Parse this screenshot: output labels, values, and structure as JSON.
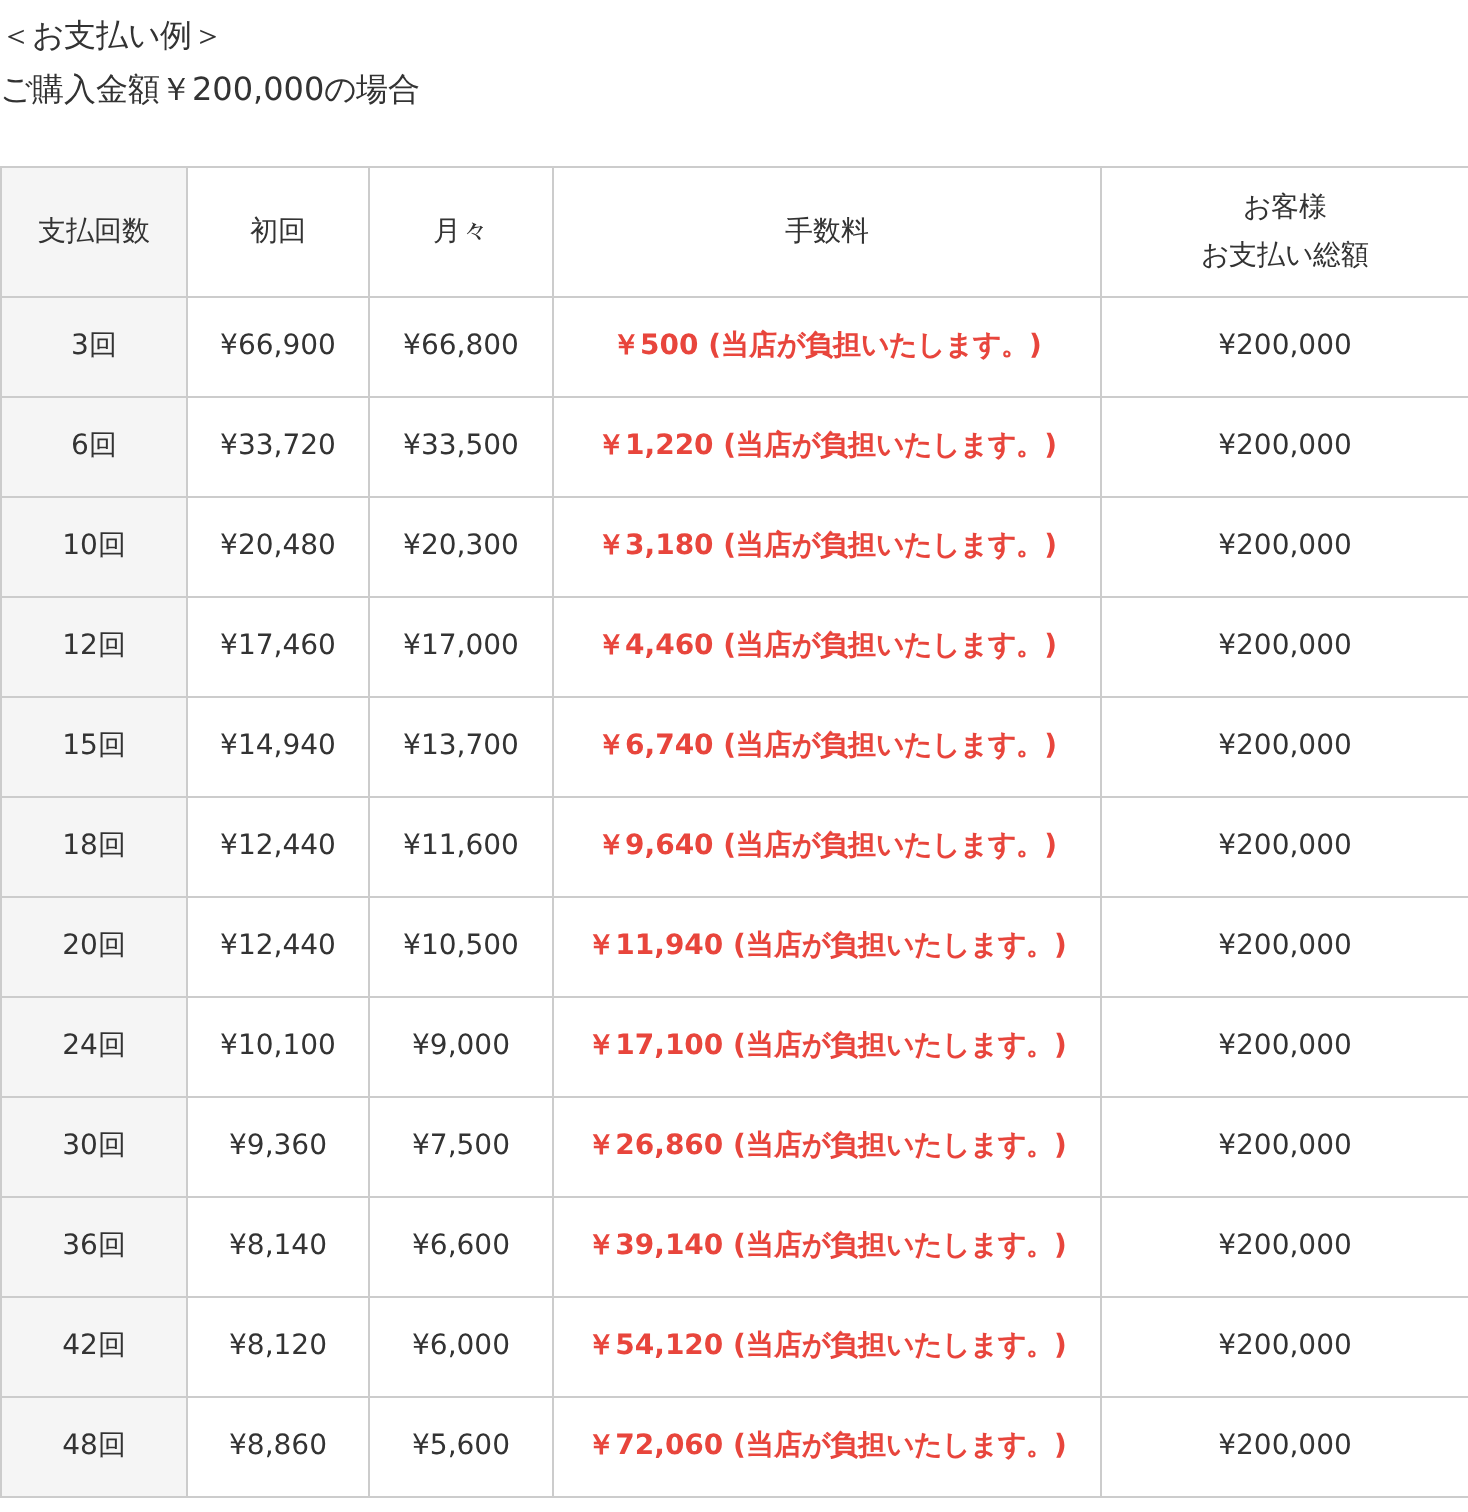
{
  "title_lines": [
    "＜お支払い例＞",
    "ご購入金額￥200,000の場合"
  ],
  "table": {
    "columns": [
      {
        "lines": [
          "支払回数"
        ]
      },
      {
        "lines": [
          "初回"
        ]
      },
      {
        "lines": [
          "月々"
        ]
      },
      {
        "lines": [
          "手数料"
        ]
      },
      {
        "lines": [
          "お客様",
          "お支払い総額"
        ]
      }
    ],
    "rows": [
      [
        "3回",
        "¥66,900",
        "¥66,800",
        "￥500 (当店が負担いたします。)",
        "¥200,000"
      ],
      [
        "6回",
        "¥33,720",
        "¥33,500",
        "￥1,220 (当店が負担いたします。)",
        "¥200,000"
      ],
      [
        "10回",
        "¥20,480",
        "¥20,300",
        "￥3,180 (当店が負担いたします。)",
        "¥200,000"
      ],
      [
        "12回",
        "¥17,460",
        "¥17,000",
        "￥4,460 (当店が負担いたします。)",
        "¥200,000"
      ],
      [
        "15回",
        "¥14,940",
        "¥13,700",
        "￥6,740 (当店が負担いたします。)",
        "¥200,000"
      ],
      [
        "18回",
        "¥12,440",
        "¥11,600",
        "￥9,640 (当店が負担いたします。)",
        "¥200,000"
      ],
      [
        "20回",
        "¥12,440",
        "¥10,500",
        "￥11,940 (当店が負担いたします。)",
        "¥200,000"
      ],
      [
        "24回",
        "¥10,100",
        "¥9,000",
        "￥17,100 (当店が負担いたします。)",
        "¥200,000"
      ],
      [
        "30回",
        "¥9,360",
        "¥7,500",
        "￥26,860 (当店が負担いたします。)",
        "¥200,000"
      ],
      [
        "36回",
        "¥8,140",
        "¥6,600",
        "￥39,140 (当店が負担いたします。)",
        "¥200,000"
      ],
      [
        "42回",
        "¥8,120",
        "¥6,000",
        "￥54,120 (当店が負担いたします。)",
        "¥200,000"
      ],
      [
        "48回",
        "¥8,860",
        "¥5,600",
        "￥72,060 (当店が負担いたします。)",
        "¥200,000"
      ]
    ]
  }
}
